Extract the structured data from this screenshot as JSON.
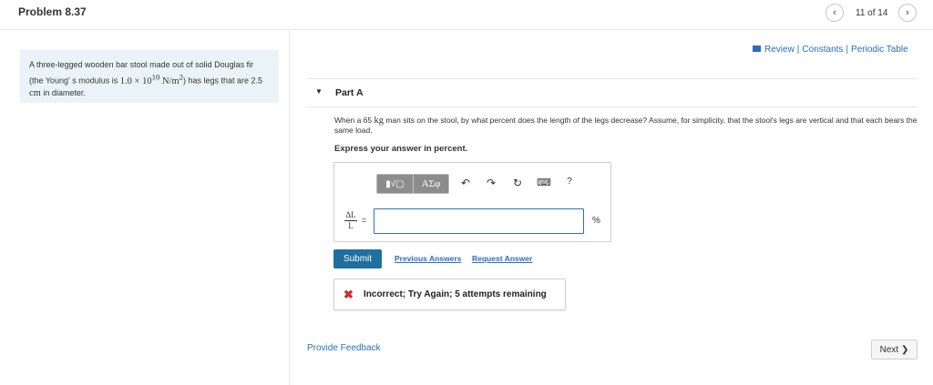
{
  "header": {
    "title": "Problem 8.37",
    "prev_icon": "‹",
    "next_icon": "›",
    "page_count": "11 of 14"
  },
  "context": {
    "text_1": "A three-legged wooden bar stool made out of solid Douglas fir (the Young'  s modulus is ",
    "math_1": "1.0 × 10",
    "math_exp": "10",
    "math_unit": " N/m",
    "math_unit_exp": "2",
    "text_2": ") has legs that are 2.5 ",
    "math_2": "cm",
    "text_3": " in diameter.",
    "paren_open": "("
  },
  "resources": {
    "review": "Review",
    "constants": "Constants",
    "periodic_table": "Periodic Table",
    "separator": "|"
  },
  "part": {
    "caret": "▼",
    "title": "Part A"
  },
  "question": {
    "text_1": "When a 65 ",
    "unit": "kg",
    "text_2": " man sits on the stool, by what percent does the length of the legs decrease? Assume, for simplicity, that the stool's legs are vertical and that each bears the same load."
  },
  "instruction": "Express your answer in percent.",
  "toolbar": {
    "templates_label": "▮√▢",
    "symbols_label": "ΑΣφ",
    "undo_icon": "↶",
    "redo_icon": "↷",
    "reset_icon": "↻",
    "keyboard_icon": "⌨",
    "help_icon": "?"
  },
  "answer": {
    "label_numerator": "ΔL",
    "label_denominator": "L",
    "equals": "=",
    "value": "",
    "unit": "%"
  },
  "actions": {
    "submit": "Submit",
    "previous_answers": "Previous Answers",
    "request_answer": "Request Answer"
  },
  "feedback": {
    "icon": "✖",
    "message": "Incorrect; Try Again; 5 attempts remaining"
  },
  "footer": {
    "provide_feedback": "Provide Feedback",
    "next": "Next ❯"
  }
}
